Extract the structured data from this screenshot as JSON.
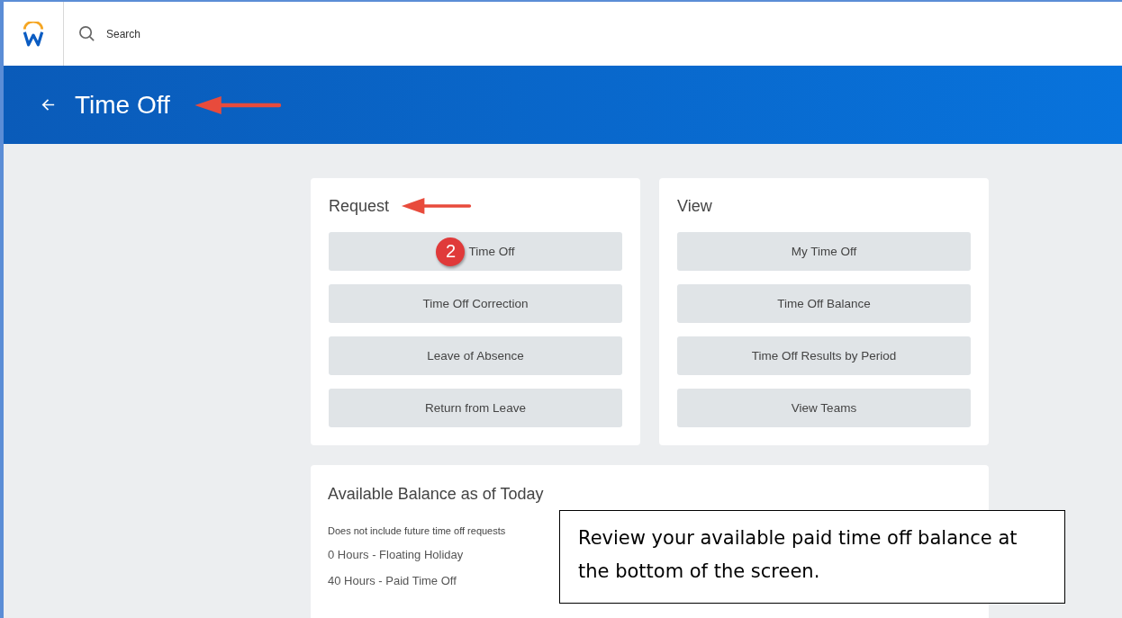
{
  "top_bar": {
    "search": {
      "placeholder": "Search"
    }
  },
  "header": {
    "title": "Time Off"
  },
  "cards": [
    {
      "title": "Request",
      "buttons": [
        {
          "label": "Time Off",
          "step": "2"
        },
        {
          "label": "Time Off Correction"
        },
        {
          "label": "Leave of Absence"
        },
        {
          "label": "Return from Leave"
        }
      ]
    },
    {
      "title": "View",
      "buttons": [
        {
          "label": "My Time Off"
        },
        {
          "label": "Time Off Balance"
        },
        {
          "label": "Time Off Results by Period"
        },
        {
          "label": "View Teams"
        }
      ]
    }
  ],
  "balance": {
    "title": "Available Balance as of Today",
    "note": "Does not include future time off requests",
    "items": [
      "0 Hours - Floating Holiday",
      "40 Hours - Paid Time Off"
    ]
  },
  "callout": {
    "text": "Review your available paid time off balance at the bottom of the screen."
  }
}
